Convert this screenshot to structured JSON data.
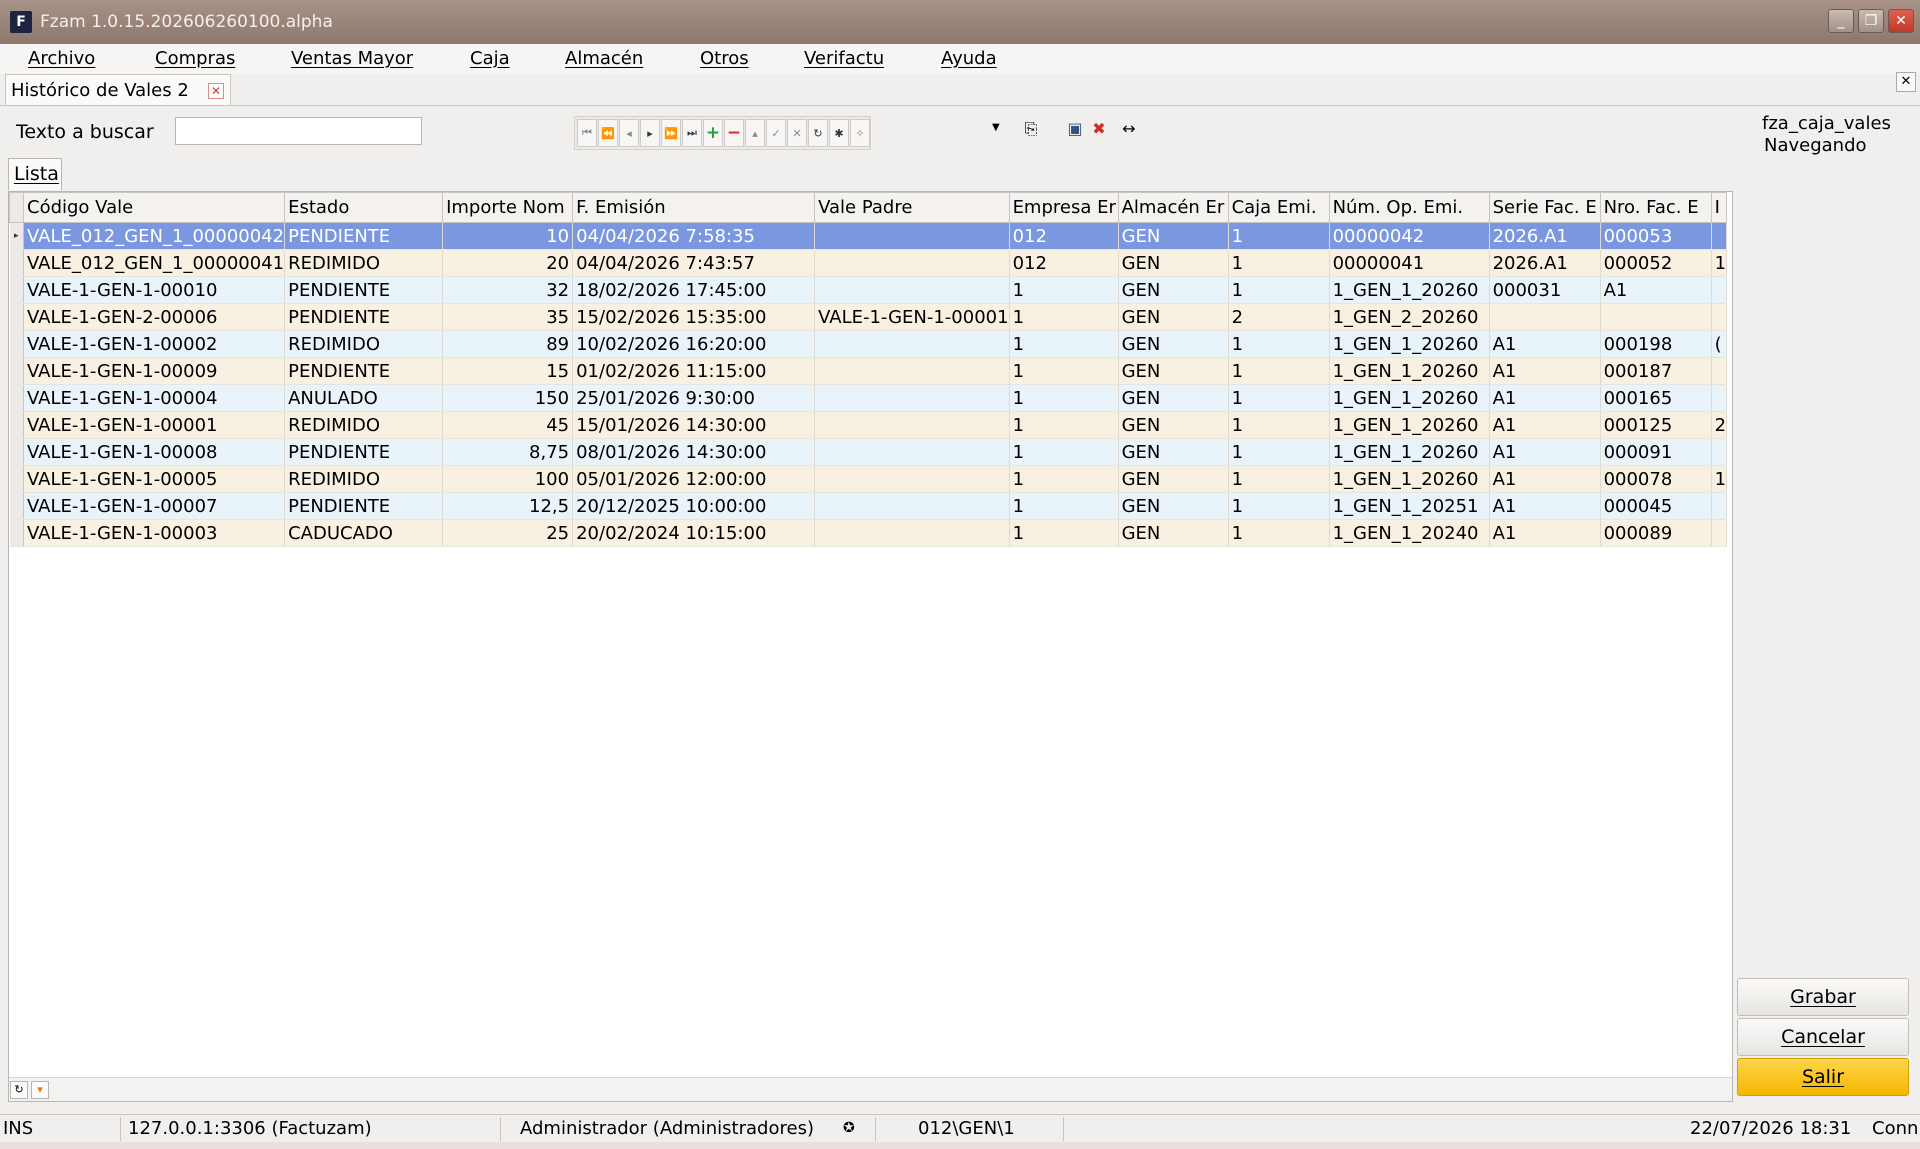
{
  "window": {
    "title": "Fzam 1.0.15.202606260100.alpha",
    "icon_letter": "F"
  },
  "menu": [
    "Archivo",
    "Compras",
    "Ventas Mayor",
    "Caja",
    "Almacén",
    "Otros",
    "Verifactu",
    "Ayuda"
  ],
  "doc_tab": {
    "label": "Histórico de Vales 2"
  },
  "search": {
    "label": "Texto a buscar",
    "value": ""
  },
  "side_info": {
    "table_name": "fza_caja_vales",
    "mode": "Navegando"
  },
  "list_tab": {
    "label": "Lista"
  },
  "grid": {
    "columns": [
      "Código Vale",
      "Estado",
      "Importe Nom",
      "F. Emisión",
      "Vale Padre",
      "Empresa Er",
      "Almacén Er",
      "Caja Emi.",
      "Núm. Op. Emi.",
      "Serie Fac. E",
      "Nro. Fac. E",
      "I"
    ],
    "rows": [
      [
        "VALE_012_GEN_1_00000042",
        "PENDIENTE",
        "10",
        "04/04/2026 7:58:35",
        "",
        "012",
        "GEN",
        "1",
        "00000042",
        "2026.A1",
        "000053",
        ""
      ],
      [
        "VALE_012_GEN_1_00000041",
        "REDIMIDO",
        "20",
        "04/04/2026 7:43:57",
        "",
        "012",
        "GEN",
        "1",
        "00000041",
        "2026.A1",
        "000052",
        "1"
      ],
      [
        "VALE-1-GEN-1-00010",
        "PENDIENTE",
        "32",
        "18/02/2026 17:45:00",
        "",
        "1",
        "GEN",
        "1",
        "1_GEN_1_20260",
        "000031",
        "A1",
        ""
      ],
      [
        "VALE-1-GEN-2-00006",
        "PENDIENTE",
        "35",
        "15/02/2026 15:35:00",
        "VALE-1-GEN-1-00001",
        "1",
        "GEN",
        "2",
        "1_GEN_2_20260",
        "",
        "",
        ""
      ],
      [
        "VALE-1-GEN-1-00002",
        "REDIMIDO",
        "89",
        "10/02/2026 16:20:00",
        "",
        "1",
        "GEN",
        "1",
        "1_GEN_1_20260",
        "A1",
        "000198",
        "("
      ],
      [
        "VALE-1-GEN-1-00009",
        "PENDIENTE",
        "15",
        "01/02/2026 11:15:00",
        "",
        "1",
        "GEN",
        "1",
        "1_GEN_1_20260",
        "A1",
        "000187",
        ""
      ],
      [
        "VALE-1-GEN-1-00004",
        "ANULADO",
        "150",
        "25/01/2026 9:30:00",
        "",
        "1",
        "GEN",
        "1",
        "1_GEN_1_20260",
        "A1",
        "000165",
        ""
      ],
      [
        "VALE-1-GEN-1-00001",
        "REDIMIDO",
        "45",
        "15/01/2026 14:30:00",
        "",
        "1",
        "GEN",
        "1",
        "1_GEN_1_20260",
        "A1",
        "000125",
        "2"
      ],
      [
        "VALE-1-GEN-1-00008",
        "PENDIENTE",
        "8,75",
        "08/01/2026 14:30:00",
        "",
        "1",
        "GEN",
        "1",
        "1_GEN_1_20260",
        "A1",
        "000091",
        ""
      ],
      [
        "VALE-1-GEN-1-00005",
        "REDIMIDO",
        "100",
        "05/01/2026 12:00:00",
        "",
        "1",
        "GEN",
        "1",
        "1_GEN_1_20260",
        "A1",
        "000078",
        "1"
      ],
      [
        "VALE-1-GEN-1-00007",
        "PENDIENTE",
        "12,5",
        "20/12/2025 10:00:00",
        "",
        "1",
        "GEN",
        "1",
        "1_GEN_1_20251",
        "A1",
        "000045",
        ""
      ],
      [
        "VALE-1-GEN-1-00003",
        "CADUCADO",
        "25",
        "20/02/2024 10:15:00",
        "",
        "1",
        "GEN",
        "1",
        "1_GEN_1_20240",
        "A1",
        "000089",
        ""
      ]
    ],
    "selected_row": 0
  },
  "actions": {
    "save": "Grabar",
    "cancel": "Cancelar",
    "exit": "Salir"
  },
  "status": {
    "mode": "INS",
    "connection": "127.0.0.1:3306 (Factuzam)",
    "user": "Administrador (Administradores)",
    "path": "012\\GEN\\1",
    "datetime": "22/07/2026 18:31",
    "conn_label": "Conn"
  },
  "colors": {
    "selected_row": "#7a97e0",
    "even_row": "#e9f3fa",
    "odd_row": "#f8f0e1",
    "primary_button": "#f4b700"
  }
}
